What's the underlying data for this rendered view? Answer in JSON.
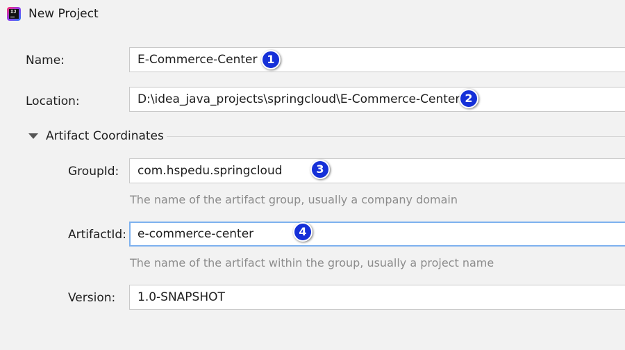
{
  "window": {
    "title": "New Project",
    "icon": "intellij-idea-icon"
  },
  "form": {
    "name": {
      "label": "Name:",
      "value": "E-Commerce-Center"
    },
    "location": {
      "label": "Location:",
      "value": "D:\\idea_java_projects\\springcloud\\E-Commerce-Center"
    },
    "artifact_section": {
      "label": "Artifact Coordinates",
      "expanded": true,
      "group_id": {
        "label": "GroupId:",
        "value": "com.hspedu.springcloud",
        "hint": "The name of the artifact group, usually a company domain"
      },
      "artifact_id": {
        "label": "ArtifactId:",
        "value": "e-commerce-center",
        "hint": "The name of the artifact within the group, usually a project name",
        "focused": true
      },
      "version": {
        "label": "Version:",
        "value": "1.0-SNAPSHOT"
      }
    }
  },
  "annotations": {
    "marker_color": "#1530d8",
    "markers": [
      "1",
      "2",
      "3",
      "4"
    ]
  },
  "colors": {
    "background": "#f2f2f2",
    "focus_border": "#7db1ef",
    "hint_text": "#8c8c8c"
  }
}
